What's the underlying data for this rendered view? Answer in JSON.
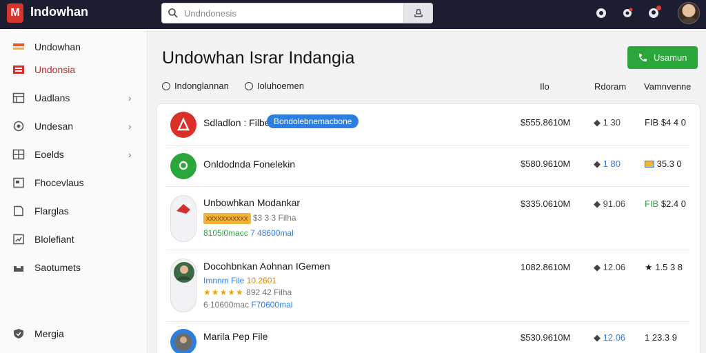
{
  "app": {
    "brand": "Indowhan",
    "logo_letter": "M"
  },
  "search": {
    "placeholder": "Undndonesis"
  },
  "sidebar": {
    "items": [
      {
        "label": "Undowhan",
        "icon": "flag-icon",
        "active": false,
        "chevron": false
      },
      {
        "label": "Undonsia",
        "icon": "folder-icon",
        "active": true,
        "chevron": false
      },
      {
        "label": "Uadlans",
        "icon": "table-icon",
        "active": false,
        "chevron": true
      },
      {
        "label": "Undesan",
        "icon": "circle-icon",
        "active": false,
        "chevron": true
      },
      {
        "label": "Eoelds",
        "icon": "grid-icon",
        "active": false,
        "chevron": true
      },
      {
        "label": "Fhocevlaus",
        "icon": "document-icon",
        "active": false,
        "chevron": false
      },
      {
        "label": "Flarglas",
        "icon": "page-icon",
        "active": false,
        "chevron": false
      },
      {
        "label": "Blolefiant",
        "icon": "checklist-icon",
        "active": false,
        "chevron": false
      },
      {
        "label": "Saotumets",
        "icon": "inbox-icon",
        "active": false,
        "chevron": false
      }
    ],
    "bottom_item": {
      "label": "Mergia",
      "icon": "shield-icon"
    }
  },
  "main": {
    "title": "Undowhan Israr Indangia",
    "primary_button": "Usamun",
    "filters": [
      "Indonglannan",
      "Ioluhoemen"
    ],
    "columns": [
      "Ilo",
      "Rdoram",
      "Vamnvenne"
    ]
  },
  "rows": [
    {
      "name": "Sdladlon : Filbe",
      "tag": "Bondolebnemacbone",
      "price": "$555.8610M",
      "rating": "1 30",
      "amount": "$4 4 0",
      "amount_prefix": "FIB",
      "colors": {
        "avatar": "#dc2f27"
      }
    },
    {
      "name": "Onldodnda Fonelekin",
      "price": "$580.9610M",
      "rating": "1 80",
      "amount": "35.3 0",
      "colors": {
        "avatar": "#2aa63b"
      }
    },
    {
      "name": "Unbowhkan Modankar",
      "badge": "xxxxxxxxxxx",
      "sub1": "$3 3 3 Filha",
      "sub2_a": "8105l0macc",
      "sub2_b": "7 48600mal",
      "price": "$335.0610M",
      "rating": "91.06",
      "amount": "$2.4 0",
      "amount_prefix": "FIB"
    },
    {
      "name": "Docohbnkan Aohnan IGemen",
      "sub0_a": "Imnnm File",
      "sub0_b": "10.2601",
      "sub1": "892 42 Filha",
      "sub2_a": "6 10600mac",
      "sub2_b": "F70600mal",
      "price": "1082.8610M",
      "rating": "12.06",
      "amount": "1.5 3 8"
    },
    {
      "name": "Marila Pep File",
      "price": "$530.9610M",
      "rating": "12.06",
      "amount": "1 23.3 9"
    }
  ]
}
